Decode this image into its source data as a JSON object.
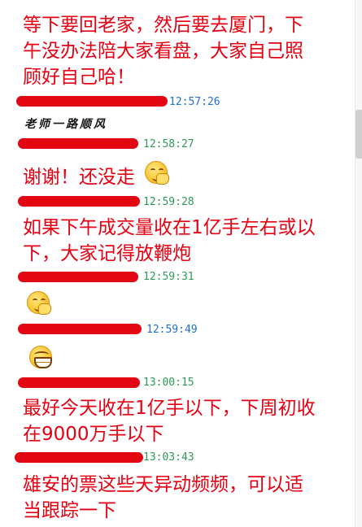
{
  "messages": [
    {
      "text_lines": [
        "等下要回老家，然后要去厦门，下",
        "午没办法陪大家看盘，大家自己照",
        "顾好自己哈！"
      ]
    },
    {
      "time": "12:57:26",
      "text": "老师一路顺风"
    },
    {
      "time": "12:58:27",
      "text": "谢谢！还没走"
    },
    {
      "time": "12:59:28",
      "text_lines": [
        "如果下午成交量收在1亿手左右或以",
        "下，大家记得放鞭炮"
      ]
    },
    {
      "time": "12:59:31"
    },
    {
      "time": "12:59:49"
    },
    {
      "time": "13:00:15",
      "text_lines": [
        "最好今天收在1亿手以下，下周初收",
        "在9000万手以下"
      ]
    },
    {
      "time": "13:03:43",
      "text_lines": [
        "雄安的票这些天异动频频，可以适",
        "当跟踪一下"
      ]
    }
  ],
  "icons": {
    "emoji_smile_hand": "smile-hand-icon",
    "emoji_grin": "grin-icon"
  }
}
